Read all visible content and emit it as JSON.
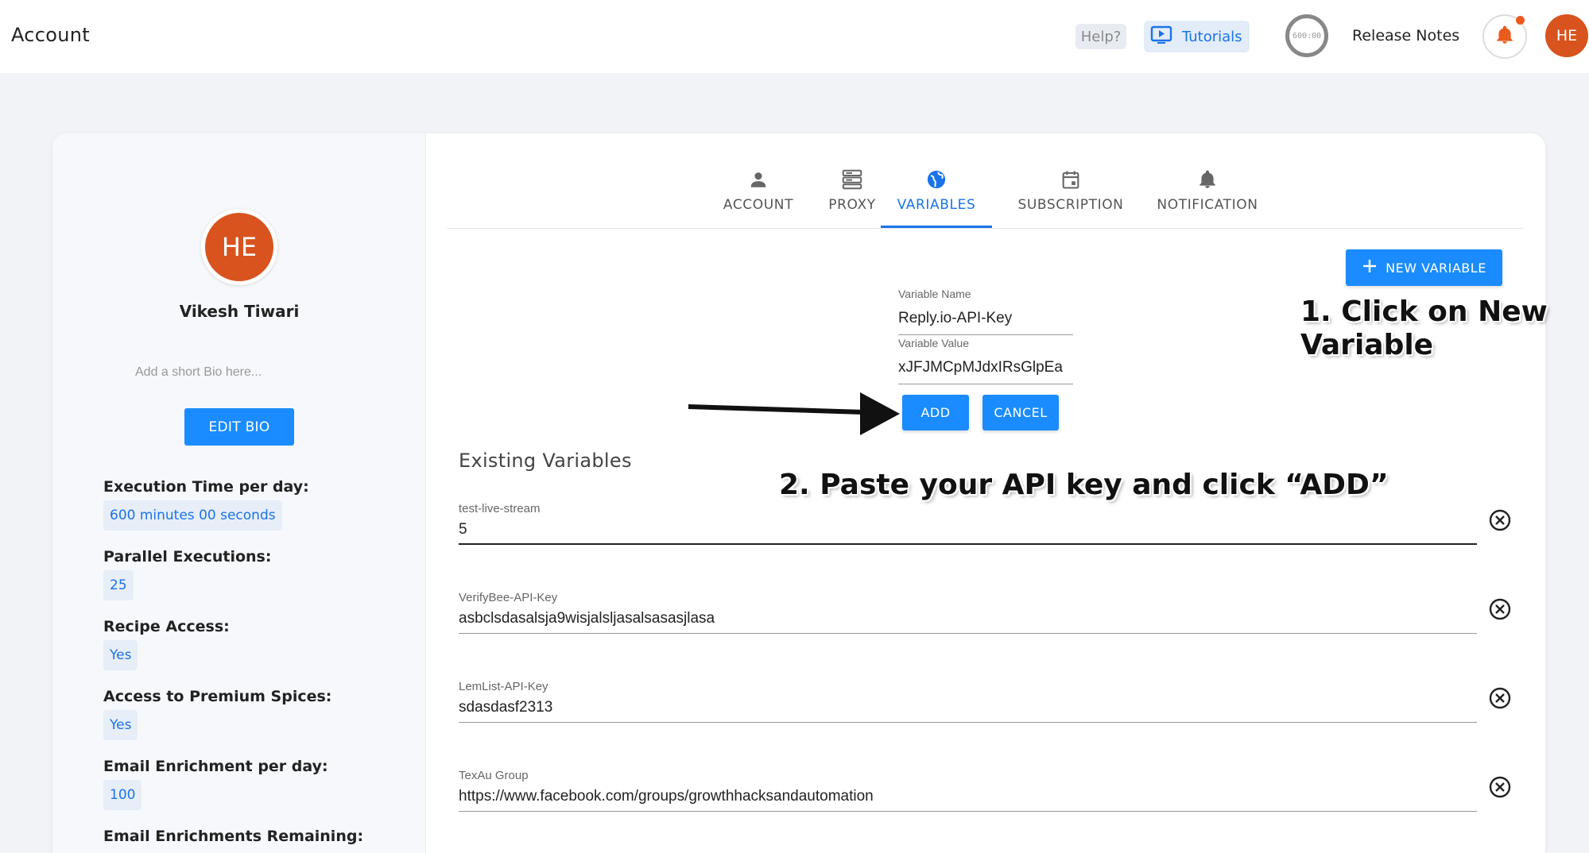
{
  "header": {
    "title": "Account",
    "help_label": "Help?",
    "tutorials_label": "Tutorials",
    "timer_text": "600:00",
    "release_notes_label": "Release Notes",
    "avatar_initials": "HE"
  },
  "profile": {
    "initials": "HE",
    "name": "Vikesh Tiwari",
    "bio_placeholder": "Add a short Bio here...",
    "edit_bio_label": "EDIT BIO",
    "stats": [
      {
        "label": "Execution Time per day:",
        "value": "600 minutes 00 seconds"
      },
      {
        "label": "Parallel Executions:",
        "value": "25"
      },
      {
        "label": "Recipe Access:",
        "value": "Yes"
      },
      {
        "label": "Access to Premium Spices:",
        "value": "Yes"
      },
      {
        "label": "Email Enrichment per day:",
        "value": "100"
      },
      {
        "label": "Email Enrichments Remaining:",
        "value": ""
      }
    ]
  },
  "tabs": [
    {
      "label": "ACCOUNT",
      "icon": "person-icon"
    },
    {
      "label": "PROXY",
      "icon": "server-icon"
    },
    {
      "label": "VARIABLES",
      "icon": "globe-icon",
      "active": true
    },
    {
      "label": "SUBSCRIPTION",
      "icon": "calendar-icon"
    },
    {
      "label": "NOTIFICATION",
      "icon": "bell-icon"
    }
  ],
  "new_variable_label": "NEW VARIABLE",
  "form": {
    "name_label": "Variable Name",
    "name_value": "Reply.io-API-Key",
    "value_label": "Variable Value",
    "value_value": "xJFJMCpMJdxIRsGlpEa",
    "add_label": "ADD",
    "cancel_label": "CANCEL"
  },
  "annotations": {
    "step1_line1": "1. Click on New",
    "step1_line2": "Variable",
    "step2": "2. Paste your API key and click “ADD”"
  },
  "existing": {
    "title": "Existing Variables",
    "variables": [
      {
        "name": "test-live-stream",
        "value": "5"
      },
      {
        "name": "VerifyBee-API-Key",
        "value": "asbclsdasalsja9wisjalsljasalsasasjlasa"
      },
      {
        "name": "LemList-API-Key",
        "value": "sdasdasf2313"
      },
      {
        "name": "TexAu Group",
        "value": "https://www.facebook.com/groups/growthhacksandautomation"
      }
    ]
  },
  "colors": {
    "accent": "#1a8cff",
    "active_tab": "#1a73e8",
    "avatar": "#d9531e"
  }
}
